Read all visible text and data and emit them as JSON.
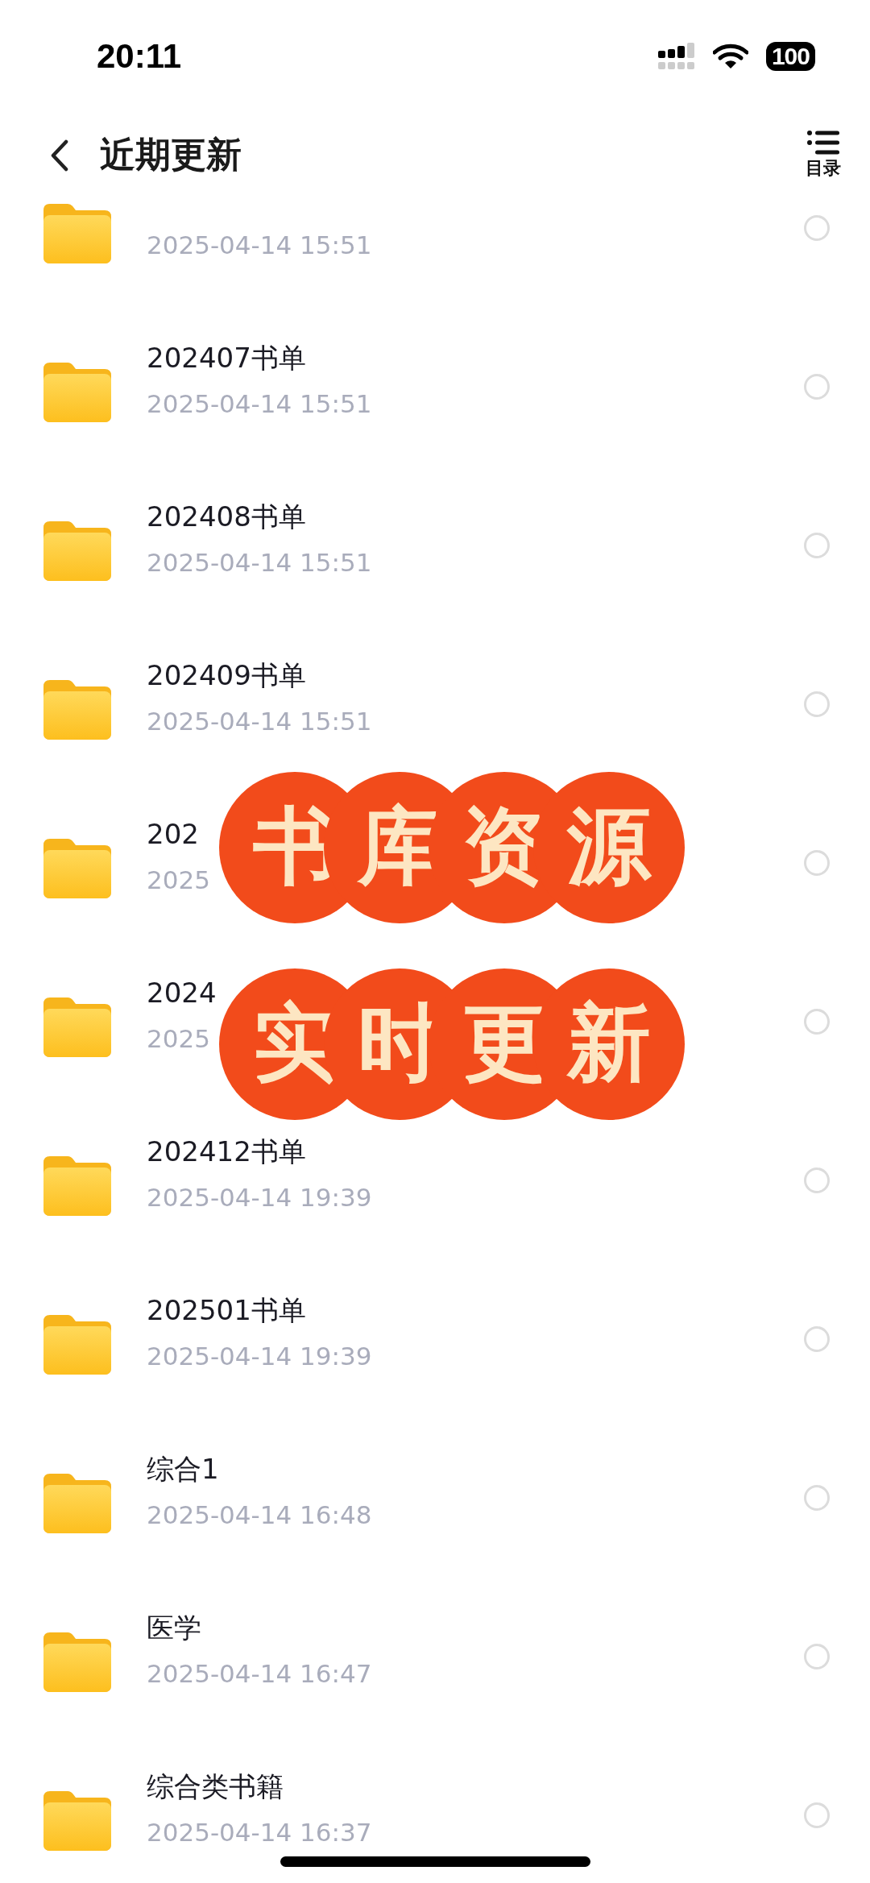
{
  "status_bar": {
    "time": "20:11",
    "battery": "100"
  },
  "header": {
    "title": "近期更新",
    "menu_label": "目录"
  },
  "folders": [
    {
      "date": "2025-04-14 15:51",
      "selected": false
    },
    {
      "title": "202407书单",
      "date": "2025-04-14 15:51",
      "selected": false
    },
    {
      "title": "202408书单",
      "date": "2025-04-14 15:51",
      "selected": false
    },
    {
      "title": "202409书单",
      "date": "2025-04-14 15:51",
      "selected": false
    },
    {
      "title": "202",
      "date": "2025",
      "selected": false
    },
    {
      "title": "2024",
      "date": "2025",
      "selected": false
    },
    {
      "title": "202412书单",
      "date": "2025-04-14 19:39",
      "selected": false
    },
    {
      "title": "202501书单",
      "date": "2025-04-14 19:39",
      "selected": false
    },
    {
      "title": "综合1",
      "date": "2025-04-14 16:48",
      "selected": false
    },
    {
      "title": "医学",
      "date": "2025-04-14 16:47",
      "selected": false
    },
    {
      "title": "综合类书籍",
      "date": "2025-04-14 16:37",
      "selected": false
    }
  ],
  "stickers": [
    {
      "chars": [
        "书",
        "库",
        "资",
        "源"
      ]
    },
    {
      "chars": [
        "实",
        "时",
        "更",
        "新"
      ]
    }
  ]
}
